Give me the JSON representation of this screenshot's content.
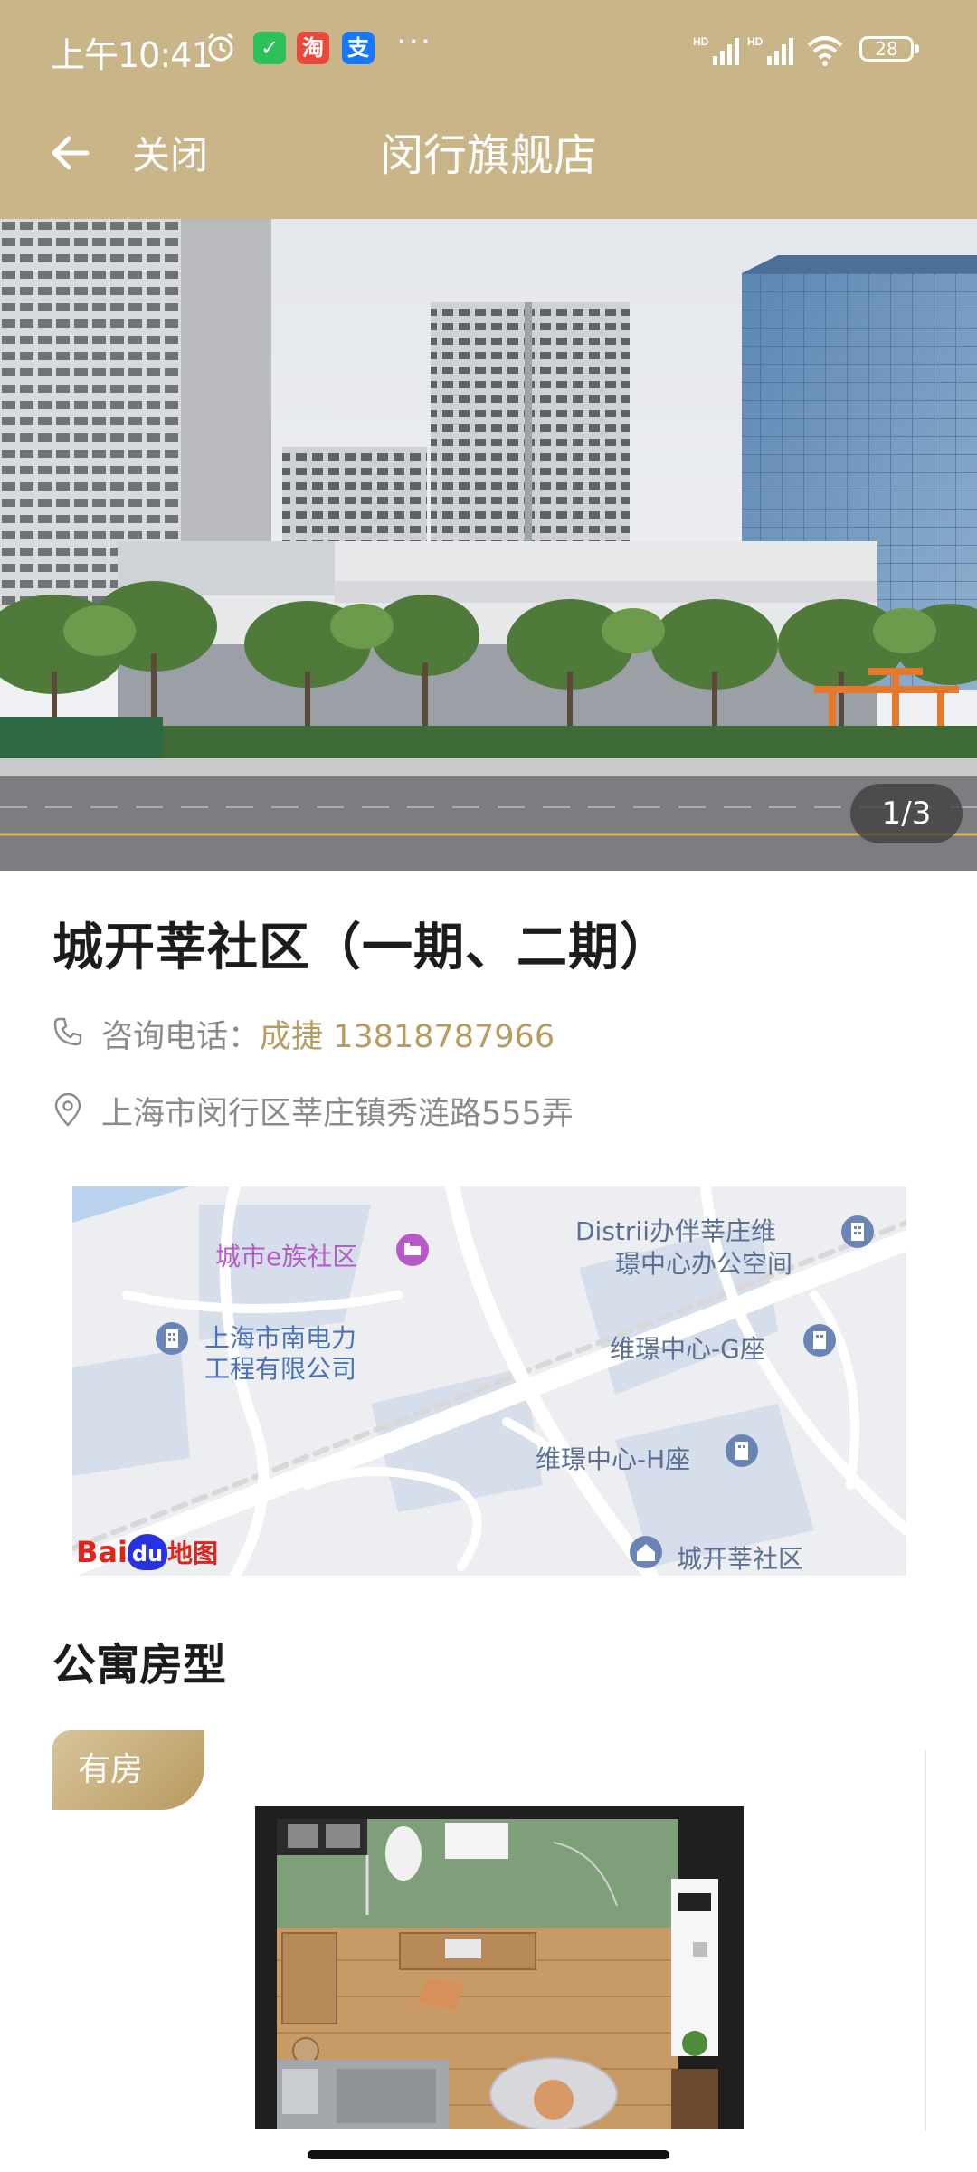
{
  "status_bar": {
    "time": "上午10:41",
    "apps": [
      {
        "icon": "wechat-icon",
        "glyph": "✓",
        "color": "#2bc158"
      },
      {
        "icon": "taobao-icon",
        "glyph": "淘",
        "color": "#e8493b"
      },
      {
        "icon": "alipay-icon",
        "glyph": "支",
        "color": "#1677ff"
      }
    ],
    "more": "···",
    "signal_label": "HD",
    "battery": "28"
  },
  "nav": {
    "close_label": "关闭",
    "title": "闵行旗舰店"
  },
  "gallery": {
    "counter": "1/3"
  },
  "community": {
    "name": "城开莘社区（一期、二期）",
    "phone_label": "咨询电话：",
    "phone_contact": "成捷 13818787966",
    "address": "上海市闵行区莘庄镇秀涟路555弄"
  },
  "map": {
    "labels": [
      "城市e族社区",
      "Distrii办伴莘庄维",
      "璟中心办公空间",
      "上海市南电力",
      "工程有限公司",
      "维璟中心-G座",
      "维璟中心-H座",
      "城开莘社区"
    ],
    "logo_text_1": "Bai",
    "logo_text_2": "du",
    "logo_text_3": "地图"
  },
  "apartments": {
    "section_title": "公寓房型",
    "badge": "有房"
  },
  "colors": {
    "header": "#c9b587",
    "accent": "#b69c5f"
  }
}
